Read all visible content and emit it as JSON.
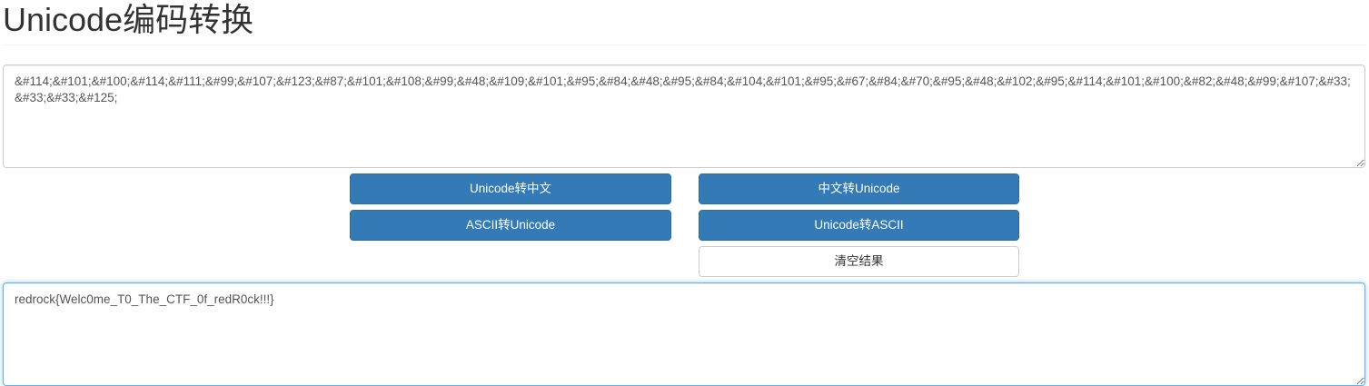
{
  "header": {
    "title": "Unicode编码转换"
  },
  "input": {
    "value": "&#114;&#101;&#100;&#114;&#111;&#99;&#107;&#123;&#87;&#101;&#108;&#99;&#48;&#109;&#101;&#95;&#84;&#48;&#95;&#84;&#104;&#101;&#95;&#67;&#84;&#70;&#95;&#48;&#102;&#95;&#114;&#101;&#100;&#82;&#48;&#99;&#107;&#33;&#33;&#33;&#125;"
  },
  "buttons": {
    "unicode_to_chinese": "Unicode转中文",
    "chinese_to_unicode": "中文转Unicode",
    "ascii_to_unicode": "ASCII转Unicode",
    "unicode_to_ascii": "Unicode转ASCII",
    "clear_result": "清空结果"
  },
  "output": {
    "value": "redrock{Welc0me_T0_The_CTF_0f_redR0ck!!!}"
  },
  "colors": {
    "primary": "#337ab7",
    "primary_border": "#2e6da4",
    "focus_border": "#66afe9"
  }
}
